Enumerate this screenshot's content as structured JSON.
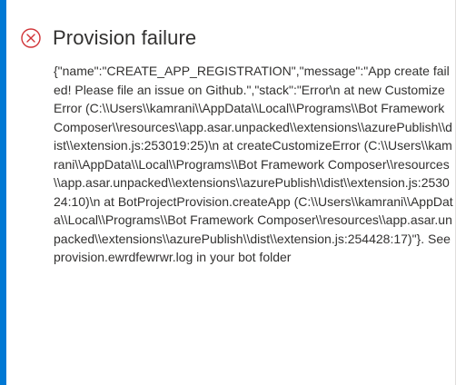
{
  "dialog": {
    "title": "Provision failure",
    "icon": "error-circle-icon",
    "icon_color": "#d13438",
    "accent_color": "#0078d4",
    "message": "{\"name\":\"CREATE_APP_REGISTRATION\",\"message\":\"App create failed! Please file an issue on Github.\",\"stack\":\"Error\\n at new CustomizeError (C:\\\\Users\\\\kamrani\\\\AppData\\\\Local\\\\Programs\\\\Bot Framework Composer\\\\resources\\\\app.asar.unpacked\\\\extensions\\\\azurePublish\\\\dist\\\\extension.js:253019:25)\\n at createCustomizeError (C:\\\\Users\\\\kamrani\\\\AppData\\\\Local\\\\Programs\\\\Bot Framework Composer\\\\resources\\\\app.asar.unpacked\\\\extensions\\\\azurePublish\\\\dist\\\\extension.js:253024:10)\\n at BotProjectProvision.createApp (C:\\\\Users\\\\kamrani\\\\AppData\\\\Local\\\\Programs\\\\Bot Framework Composer\\\\resources\\\\app.asar.unpacked\\\\extensions\\\\azurePublish\\\\dist\\\\extension.js:254428:17)\"}. See provision.ewrdfewrwr.log in your bot folder"
  }
}
